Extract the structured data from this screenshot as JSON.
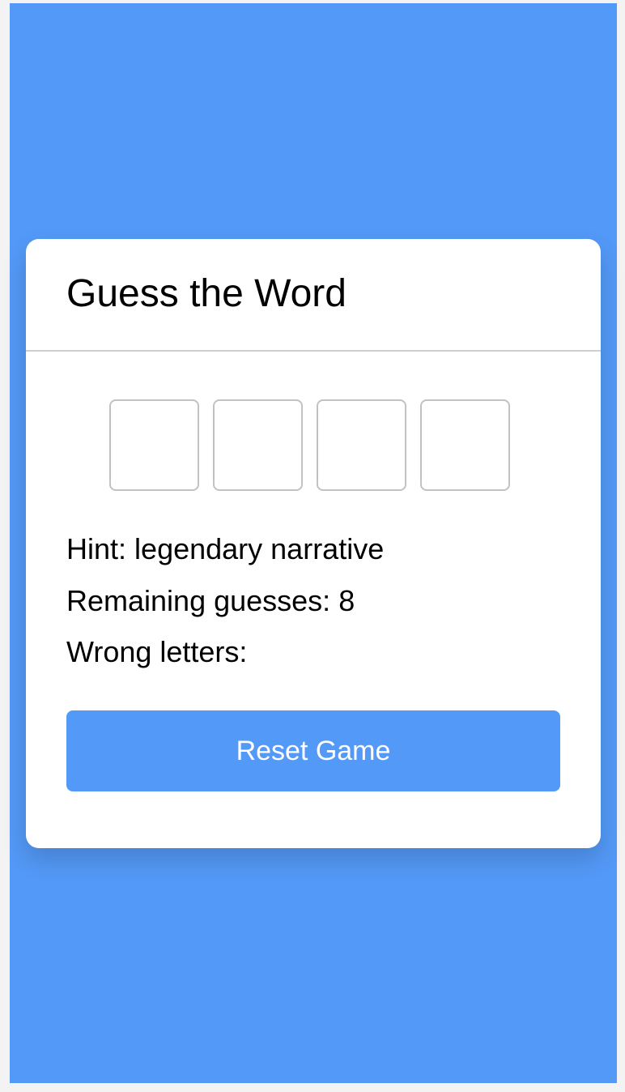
{
  "header": {
    "title": "Guess the Word"
  },
  "word": {
    "letters": [
      "",
      "",
      "",
      ""
    ]
  },
  "hint": {
    "label": "Hint:",
    "value": "legendary narrative"
  },
  "remaining": {
    "label": "Remaining guesses:",
    "value": "8"
  },
  "wrong_letters": {
    "label": "Wrong letters:",
    "value": ""
  },
  "actions": {
    "reset_label": "Reset Game"
  },
  "colors": {
    "background": "#5399f7",
    "card": "#ffffff",
    "button": "#5399f7",
    "button_text": "#ffffff",
    "box_border": "#c2c2c2",
    "divider": "#cfcfcf"
  }
}
